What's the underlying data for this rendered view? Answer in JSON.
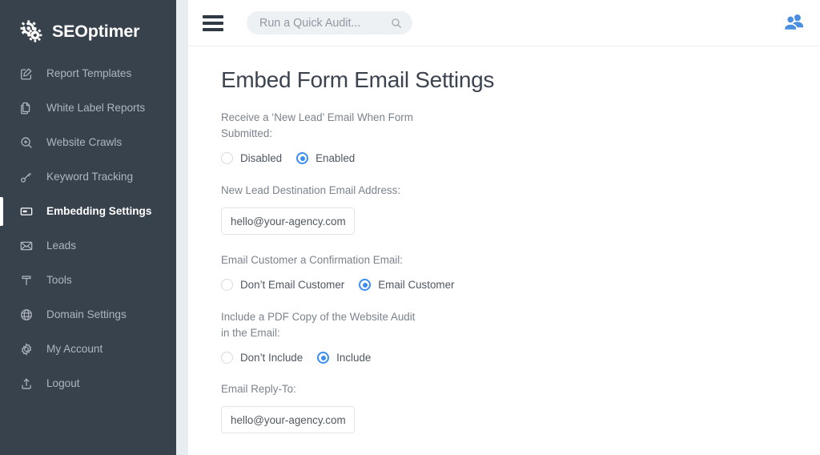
{
  "brand": {
    "name": "SEOptimer",
    "logo_icon": "gears-icon",
    "sidebar_color": "#38424d",
    "accent_color": "#3b8df0"
  },
  "sidebar": {
    "items": [
      {
        "label": "Report Templates",
        "icon": "pencil-square-icon",
        "active": false
      },
      {
        "label": "White Label Reports",
        "icon": "documents-copy-icon",
        "active": false
      },
      {
        "label": "Website Crawls",
        "icon": "magnifier-plus-icon",
        "active": false
      },
      {
        "label": "Keyword Tracking",
        "icon": "key-icon",
        "active": false
      },
      {
        "label": "Embedding Settings",
        "icon": "embed-card-icon",
        "active": true
      },
      {
        "label": "Leads",
        "icon": "envelope-icon",
        "active": false
      },
      {
        "label": "Tools",
        "icon": "hammer-icon",
        "active": false
      },
      {
        "label": "Domain Settings",
        "icon": "globe-icon",
        "active": false
      },
      {
        "label": "My Account",
        "icon": "gear-icon",
        "active": false
      },
      {
        "label": "Logout",
        "icon": "upload-logout-icon",
        "active": false
      }
    ]
  },
  "topbar": {
    "menu_icon": "hamburger-icon",
    "search": {
      "placeholder": "Run a Quick Audit...",
      "icon": "search-icon"
    },
    "account_icon": "users-icon"
  },
  "main": {
    "title": "Embed Form Email Settings",
    "fields": [
      {
        "label": "Receive a ‘New Lead’ Email When Form Submitted:",
        "type": "radio",
        "options": [
          {
            "label": "Disabled",
            "selected": false
          },
          {
            "label": "Enabled",
            "selected": true
          }
        ]
      },
      {
        "label": "New Lead Destination Email Address:",
        "type": "text",
        "value": "hello@your-agency.com"
      },
      {
        "label": "Email Customer a Confirmation Email:",
        "type": "radio",
        "options": [
          {
            "label": "Don’t Email Customer",
            "selected": false
          },
          {
            "label": "Email Customer",
            "selected": true
          }
        ]
      },
      {
        "label": "Include a PDF Copy of the Website Audit in the Email:",
        "type": "radio",
        "options": [
          {
            "label": "Don’t Include",
            "selected": false
          },
          {
            "label": "Include",
            "selected": true
          }
        ]
      },
      {
        "label": "Email Reply-To:",
        "type": "text",
        "value": "hello@your-agency.com"
      }
    ]
  }
}
